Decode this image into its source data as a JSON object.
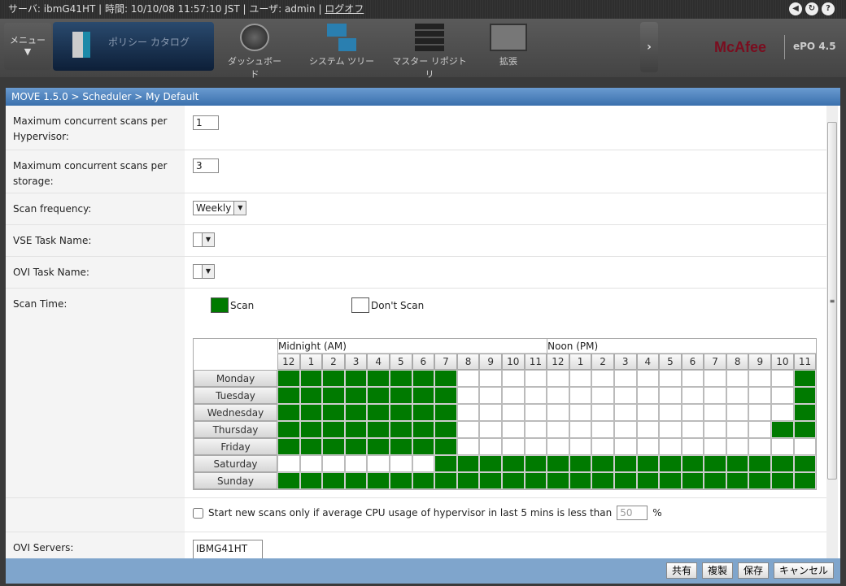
{
  "topbar": {
    "status": "サーバ: ibmG41HT | 時間: 10/10/08 11:57:10 JST | ユーザ: admin | ",
    "logoff": "ログオフ",
    "icons": [
      "back-icon",
      "refresh-icon",
      "help-icon"
    ]
  },
  "nav": {
    "menu": "メニュー",
    "menu_arrow": "▼",
    "active": "ポリシー カタログ",
    "items": [
      "ダッシュボード",
      "システム ツリー",
      "マスター リポジトリ",
      "拡張"
    ],
    "more": "›",
    "brand": "McAfee",
    "product": "ePO 4.5"
  },
  "panel": {
    "breadcrumb": "MOVE 1.5.0 > Scheduler > My Default"
  },
  "form": {
    "max_hyp_label": "Maximum concurrent scans per Hypervisor:",
    "max_hyp_value": "1",
    "max_storage_label": "Maximum concurrent scans per storage:",
    "max_storage_value": "3",
    "freq_label": "Scan frequency:",
    "freq_value": "Weekly",
    "vse_label": "VSE Task Name:",
    "vse_value": "",
    "ovi_label": "OVI Task Name:",
    "ovi_value": "",
    "scantime_label": "Scan Time:",
    "legend_scan": "Scan",
    "legend_noscan": "Don't Scan",
    "cpu_text": "Start new scans only if average CPU usage of hypervisor in last 5 mins is less than",
    "cpu_value": "50",
    "cpu_unit": "%",
    "cpu_checked": false,
    "ovi_servers_label": "OVI Servers:",
    "ovi_servers_value": "IBMG41HT"
  },
  "schedule": {
    "am_label": "Midnight (AM)",
    "pm_label": "Noon (PM)",
    "hours": [
      "12",
      "1",
      "2",
      "3",
      "4",
      "5",
      "6",
      "7",
      "8",
      "9",
      "10",
      "11",
      "12",
      "1",
      "2",
      "3",
      "4",
      "5",
      "6",
      "7",
      "8",
      "9",
      "10",
      "11"
    ],
    "days": [
      {
        "name": "Monday",
        "slots": "111111110000000000000001"
      },
      {
        "name": "Tuesday",
        "slots": "111111110000000000000001"
      },
      {
        "name": "Wednesday",
        "slots": "111111110000000000000001"
      },
      {
        "name": "Thursday",
        "slots": "111111110000000000000011"
      },
      {
        "name": "Friday",
        "slots": "111111110000000000000000"
      },
      {
        "name": "Saturday",
        "slots": "000000011111111111111111"
      },
      {
        "name": "Sunday",
        "slots": "111111111111111111111111"
      }
    ],
    "scan_color": "#007a00"
  },
  "footer": {
    "share": "共有",
    "duplicate": "複製",
    "save": "保存",
    "cancel": "キャンセル"
  }
}
